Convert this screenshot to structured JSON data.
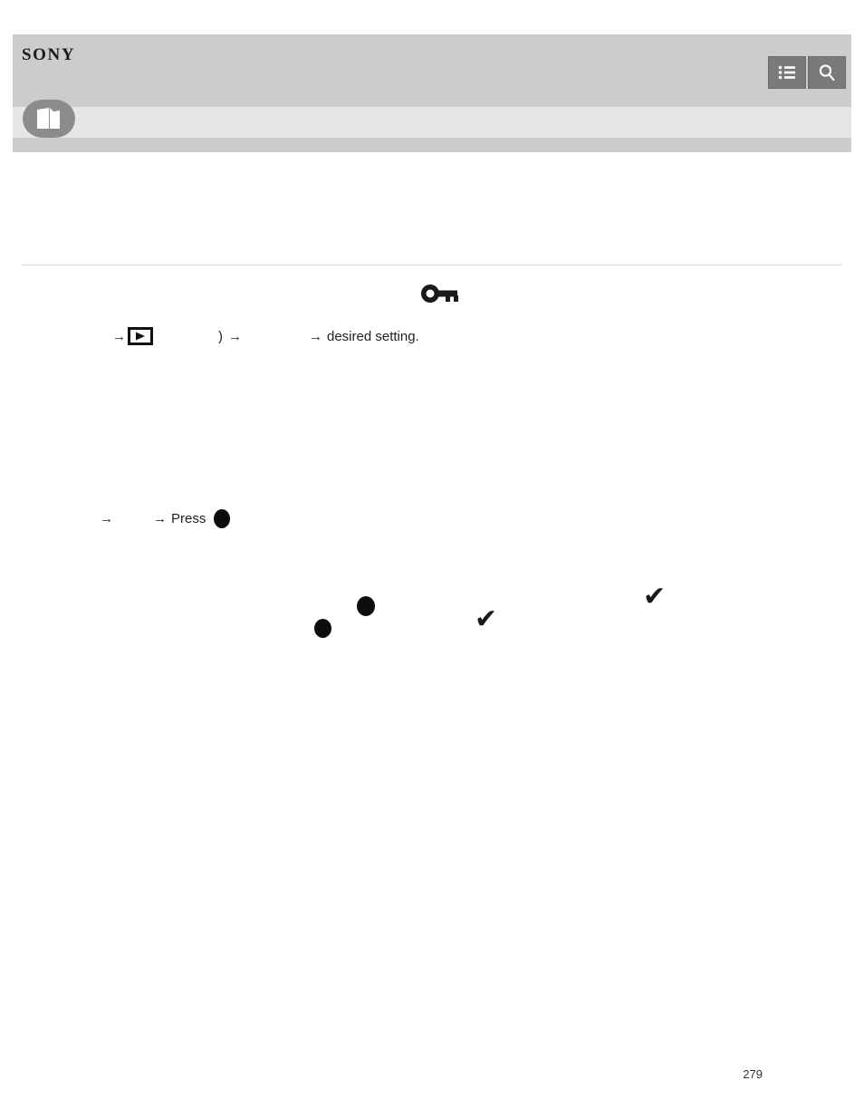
{
  "header": {
    "logo_text": "SONY",
    "logo_icon": "sony-wordmark",
    "guide_tab_icon": "help-guide-book-icon",
    "buttons": [
      {
        "name": "menu-button",
        "icon": "list-menu-icon",
        "label": ""
      },
      {
        "name": "search-button",
        "icon": "search-magnifier-icon",
        "label": ""
      }
    ]
  },
  "content": {
    "title": "",
    "step_one": {
      "protect_icon": "key-protect-icon",
      "arrow": "→",
      "playback_icon": "playback-triangle-icon",
      "menu_label": "",
      "paren": ")",
      "arrow2": "→",
      "item_label": "",
      "arrow3": "→",
      "trailing_text": "desired setting."
    },
    "options": [
      {
        "name": "option-center-dot-1",
        "icon": "filled-circle-icon",
        "glyph": "●",
        "label": ""
      },
      {
        "name": "option-center-dot-2",
        "icon": "filled-circle-icon",
        "glyph": "●",
        "label": ""
      },
      {
        "name": "option-check-1",
        "icon": "checkmark-icon",
        "glyph": "✔",
        "label": ""
      },
      {
        "name": "option-check-2",
        "icon": "checkmark-icon",
        "glyph": "✔",
        "label": ""
      }
    ],
    "step_two": {
      "arrow": "→",
      "image_label": "",
      "arrow2": "→",
      "press_text": "Press",
      "center_button_icon": "filled-circle-icon",
      "center_button_glyph": "●"
    }
  },
  "footer": {
    "page_number": "279"
  },
  "colors": {
    "header_band": "#cccccc",
    "header_band_light": "#e6e6e6",
    "button_bg": "#7a7a7a",
    "rule": "#dddddd",
    "text": "#222222"
  }
}
